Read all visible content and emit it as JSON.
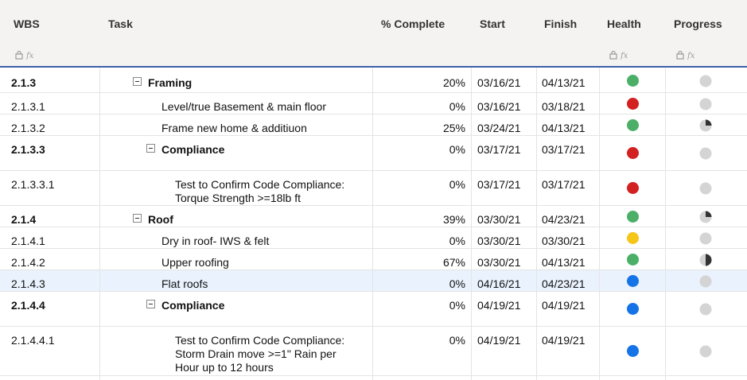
{
  "columns": {
    "wbs": "WBS",
    "task": "Task",
    "pct": "% Complete",
    "start": "Start",
    "finish": "Finish",
    "health": "Health",
    "progress": "Progress"
  },
  "header_icons": [
    "lock-icon",
    "formula-icon"
  ],
  "colors": {
    "green": "#4caf68",
    "red": "#d32020",
    "yellow": "#f5c518",
    "blue": "#1473e6",
    "gray": "#d4d4d4",
    "progress_dark": "#333333",
    "accent_line": "#3b5fa8",
    "selected_row": "#eaf2fd"
  },
  "rows": [
    {
      "wbs": "2.1.3",
      "task": "Framing",
      "pct": "20%",
      "start": "03/16/21",
      "finish": "04/13/21",
      "bold": true,
      "indent": 1,
      "toggle": true,
      "health": "green",
      "progress": 0
    },
    {
      "wbs": "2.1.3.1",
      "task": "Level/true Basement & main floor",
      "pct": "0%",
      "start": "03/16/21",
      "finish": "03/18/21",
      "indent": 2,
      "health": "red",
      "progress": 0
    },
    {
      "wbs": "2.1.3.2",
      "task": "Frame new home & additiuon",
      "pct": "25%",
      "start": "03/24/21",
      "finish": "04/13/21",
      "indent": 2,
      "health": "green",
      "progress": 0.25
    },
    {
      "wbs": "2.1.3.3",
      "task": "Compliance",
      "pct": "0%",
      "start": "03/17/21",
      "finish": "03/17/21",
      "bold": true,
      "indent": 2,
      "toggle": true,
      "health": "red",
      "progress": 0
    },
    {
      "wbs": "2.1.3.3.1",
      "task": "Test to Confirm Code Compliance: Torque Strength >=18lb ft",
      "lines": [
        "Test to Confirm Code Compliance:",
        "Torque Strength >=18lb ft"
      ],
      "pct": "0%",
      "start": "03/17/21",
      "finish": "03/17/21",
      "indent": 3,
      "health": "red",
      "progress": 0
    },
    {
      "wbs": "2.1.4",
      "task": "Roof",
      "pct": "39%",
      "start": "03/30/21",
      "finish": "04/23/21",
      "bold": true,
      "indent": 1,
      "toggle": true,
      "health": "green",
      "progress": 0.25
    },
    {
      "wbs": "2.1.4.1",
      "task": "Dry in roof- IWS & felt",
      "pct": "0%",
      "start": "03/30/21",
      "finish": "03/30/21",
      "indent": 2,
      "health": "yellow",
      "progress": 0
    },
    {
      "wbs": "2.1.4.2",
      "task": "Upper roofing",
      "pct": "67%",
      "start": "03/30/21",
      "finish": "04/13/21",
      "indent": 2,
      "health": "green",
      "progress": 0.5
    },
    {
      "wbs": "2.1.4.3",
      "task": "Flat roofs",
      "pct": "0%",
      "start": "04/16/21",
      "finish": "04/23/21",
      "indent": 2,
      "health": "blue",
      "progress": 0,
      "selected": true
    },
    {
      "wbs": "2.1.4.4",
      "task": "Compliance",
      "pct": "0%",
      "start": "04/19/21",
      "finish": "04/19/21",
      "bold": true,
      "indent": 2,
      "toggle": true,
      "health": "blue",
      "progress": 0
    },
    {
      "wbs": "2.1.4.4.1",
      "task": "Test to Confirm Code Compliance: Storm Drain move >=1\" Rain per Hour up to 12 hours",
      "lines": [
        "Test to Confirm Code Compliance:",
        "Storm Drain move >=1\" Rain per",
        "Hour up to 12 hours"
      ],
      "pct": "0%",
      "start": "04/19/21",
      "finish": "04/19/21",
      "indent": 3,
      "health": "blue",
      "progress": 0
    }
  ]
}
